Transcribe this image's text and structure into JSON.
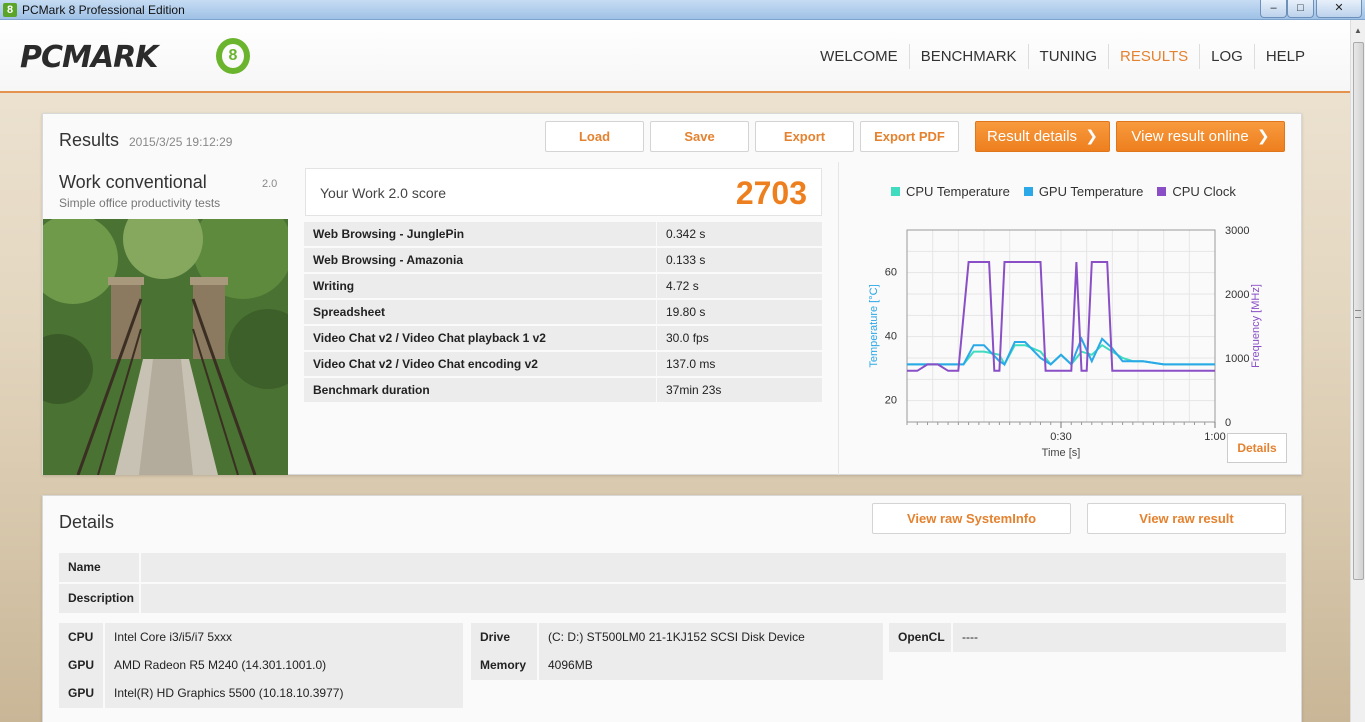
{
  "window": {
    "title": "PCMark 8 Professional Edition",
    "min": "‒",
    "max": "□",
    "close": "✕"
  },
  "header": {
    "logo_text": "PCMARK",
    "logo_num": "8",
    "nav": [
      "WELCOME",
      "BENCHMARK",
      "TUNING",
      "RESULTS",
      "LOG",
      "HELP"
    ],
    "active": "RESULTS"
  },
  "results": {
    "title": "Results",
    "date": "2015/3/25 19:12:29",
    "buttons": {
      "load": "Load",
      "save": "Save",
      "export": "Export",
      "export_pdf": "Export PDF",
      "result_details": "Result details",
      "view_online": "View result online"
    },
    "test": {
      "name": "Work conventional",
      "version": "2.0",
      "desc": "Simple office productivity tests"
    },
    "score": {
      "label": "Your Work 2.0 score",
      "value": "2703"
    },
    "rows": [
      {
        "k": "Web Browsing - JunglePin",
        "v": "0.342 s"
      },
      {
        "k": "Web Browsing - Amazonia",
        "v": "0.133 s"
      },
      {
        "k": "Writing",
        "v": "4.72 s"
      },
      {
        "k": "Spreadsheet",
        "v": "19.80 s"
      },
      {
        "k": "Video Chat v2 / Video Chat playback 1 v2",
        "v": "30.0 fps"
      },
      {
        "k": "Video Chat v2 / Video Chat encoding v2",
        "v": "137.0 ms"
      },
      {
        "k": "Benchmark duration",
        "v": "37min 23s"
      }
    ],
    "chart_details": "Details"
  },
  "chart_data": {
    "type": "line",
    "xlabel": "Time [s]",
    "ylabel": "Temperature [°C]",
    "y2label": "Frequency [MHz]",
    "xticks": [
      "0:30",
      "1:00"
    ],
    "yticks": [
      "20",
      "40",
      "60"
    ],
    "y2ticks": [
      "0",
      "1000",
      "2000",
      "3000"
    ],
    "ylim": [
      13,
      73
    ],
    "y2lim": [
      0,
      3000
    ],
    "xlim": [
      0,
      60
    ],
    "legend_position": "top",
    "grid": true,
    "series": [
      {
        "name": "CPU Temperature",
        "color": "#3fdcc0",
        "axis": "left",
        "x": [
          0,
          10,
          11,
          13,
          15,
          18,
          19,
          21,
          23,
          26,
          28,
          30,
          32,
          34,
          36,
          38,
          40,
          42,
          44,
          46,
          50,
          55,
          60
        ],
        "y": [
          31,
          31,
          31,
          35,
          35,
          34,
          31,
          37,
          37,
          35,
          31,
          34,
          31,
          35,
          34,
          37,
          35,
          33,
          32,
          32,
          31,
          31,
          31
        ]
      },
      {
        "name": "GPU Temperature",
        "color": "#2aa8e8",
        "axis": "left",
        "x": [
          0,
          10,
          11,
          13,
          15,
          18,
          19,
          21,
          23,
          26,
          28,
          30,
          32,
          34,
          36,
          38,
          40,
          42,
          44,
          46,
          50,
          55,
          60
        ],
        "y": [
          31,
          31,
          31,
          37,
          37,
          32,
          31,
          38,
          38,
          33,
          31,
          34,
          31,
          39,
          32,
          39,
          36,
          32,
          32,
          32,
          31,
          31,
          31
        ]
      },
      {
        "name": "CPU Clock",
        "color": "#8a4fc6",
        "axis": "right",
        "x": [
          0,
          2,
          4,
          6,
          8,
          10,
          12,
          16,
          17,
          18,
          19,
          21,
          24,
          26,
          27,
          29,
          30,
          32,
          33,
          34,
          35,
          36,
          37,
          39,
          40,
          41,
          42,
          60
        ],
        "y": [
          800,
          800,
          900,
          900,
          800,
          800,
          2500,
          2500,
          800,
          800,
          2500,
          2500,
          2500,
          2500,
          800,
          800,
          800,
          800,
          2500,
          800,
          800,
          2500,
          2500,
          2500,
          800,
          800,
          800,
          800
        ]
      }
    ]
  },
  "details": {
    "title": "Details",
    "btn_sysinfo": "View raw SystemInfo",
    "btn_raw": "View raw result",
    "name_label": "Name",
    "desc_label": "Description",
    "cpu_label": "CPU",
    "cpu": "Intel Core i3/i5/i7 5xxx",
    "gpu1_label": "GPU",
    "gpu1": "AMD Radeon R5 M240 (14.301.1001.0)",
    "gpu2_label": "GPU",
    "gpu2": "Intel(R) HD Graphics 5500 (10.18.10.3977)",
    "drive_label": "Drive",
    "drive": "(C: D:) ST500LM0 21-1KJ152 SCSI Disk Device",
    "memory_label": "Memory",
    "memory": "4096MB",
    "opencl_label": "OpenCL",
    "opencl": "----"
  }
}
